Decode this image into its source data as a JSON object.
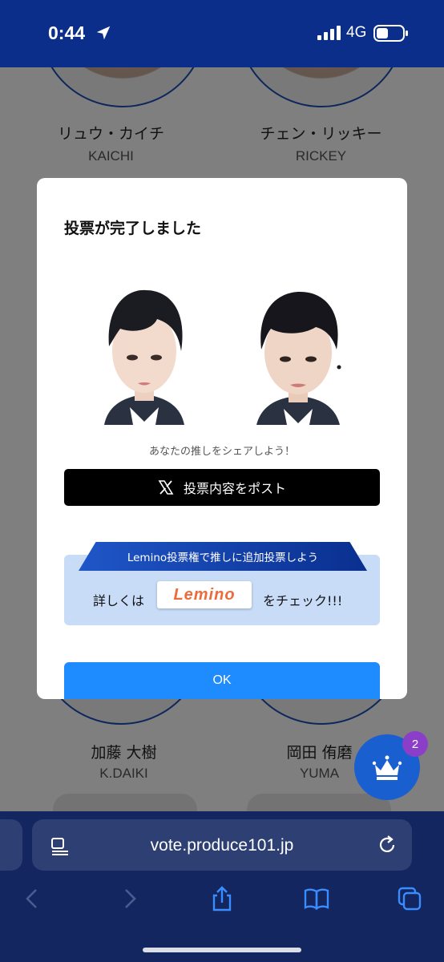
{
  "status_bar": {
    "time": "0:44",
    "network": "4G"
  },
  "background": {
    "members": [
      {
        "name": "リュウ・カイチ",
        "romanized": "KAICHI"
      },
      {
        "name": "チェン・リッキー",
        "romanized": "RICKEY"
      },
      {
        "name": "加藤 大樹",
        "romanized": "K.DAIKI"
      },
      {
        "name": "岡田 侑磨",
        "romanized": "YUMA"
      }
    ]
  },
  "modal": {
    "title": "投票が完了しました",
    "share_text": "あなたの推しをシェアしよう！",
    "post_button_label": "投票内容をポスト",
    "lemino": {
      "banner": "Lemino投票権で推しに追加投票しよう",
      "prefix": "詳しくは",
      "logo_text": "Lemino",
      "suffix": "をチェック!!!"
    },
    "ok_label": "OK"
  },
  "crown_badge_count": "2",
  "browser": {
    "url": "vote.produce101.jp"
  },
  "colors": {
    "header_navy": "#0b2e8a",
    "ok_blue": "#1e8bff",
    "lemino_orange": "#ef6a3a",
    "badge_purple": "#8b3fc8"
  }
}
